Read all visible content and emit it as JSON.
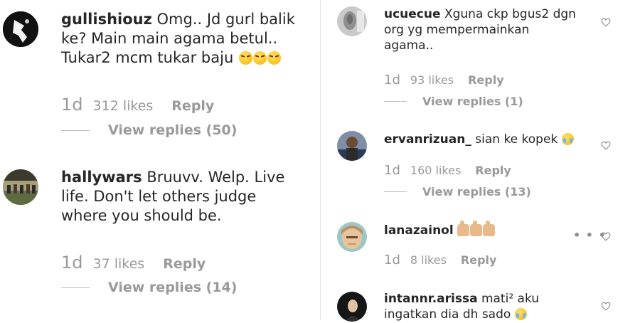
{
  "left_comments": [
    {
      "username": "gullishiouz",
      "text_line1": "Omg.. Jd gurl balik",
      "text_line2": "ke? Main main agama betul..",
      "text_line3": "Tukar2 mcm tukar baju",
      "emoji": "angry-face x3",
      "time": "1d",
      "likes": "312 likes",
      "reply": "Reply",
      "view_replies": "View replies (50)"
    },
    {
      "username": "hallywars",
      "text_line1": "Bruuvv. Welp. Live",
      "text_line2": "life. Don't let others judge",
      "text_line3": "where you should be.",
      "time": "1d",
      "likes": "37 likes",
      "reply": "Reply",
      "view_replies": "View replies (14)"
    }
  ],
  "right_comments": [
    {
      "username": "ucuecue",
      "text_line1": "Xguna ckp bgus2 dgn",
      "text_line2": "org yg mempermainkan",
      "text_line3": "agama..",
      "time": "1d",
      "likes": "93 likes",
      "reply": "Reply",
      "view_replies": "View replies (1)"
    },
    {
      "username": "ervanrizuan_",
      "text_line1": "sian ke kopek",
      "emoji": "crying-laughing face",
      "time": "1d",
      "likes": "160 likes",
      "reply": "Reply",
      "view_replies": "View replies (13)"
    },
    {
      "username": "lanazainol",
      "emoji": "thumbs-up x3",
      "time": "1d",
      "likes": "8 likes",
      "reply": "Reply"
    },
    {
      "username": "intannr.arissa",
      "text_line1": "mati² aku",
      "text_line2": "ingatkan dia dh sado",
      "emoji": "crying-laughing face"
    }
  ],
  "icons": {
    "like": "heart-outline-icon",
    "more": "more-options-icon"
  },
  "more_options_glyph": "• • •",
  "colors": {
    "text": "#262626",
    "meta": "#999999",
    "divider": "#e6e6e6"
  }
}
